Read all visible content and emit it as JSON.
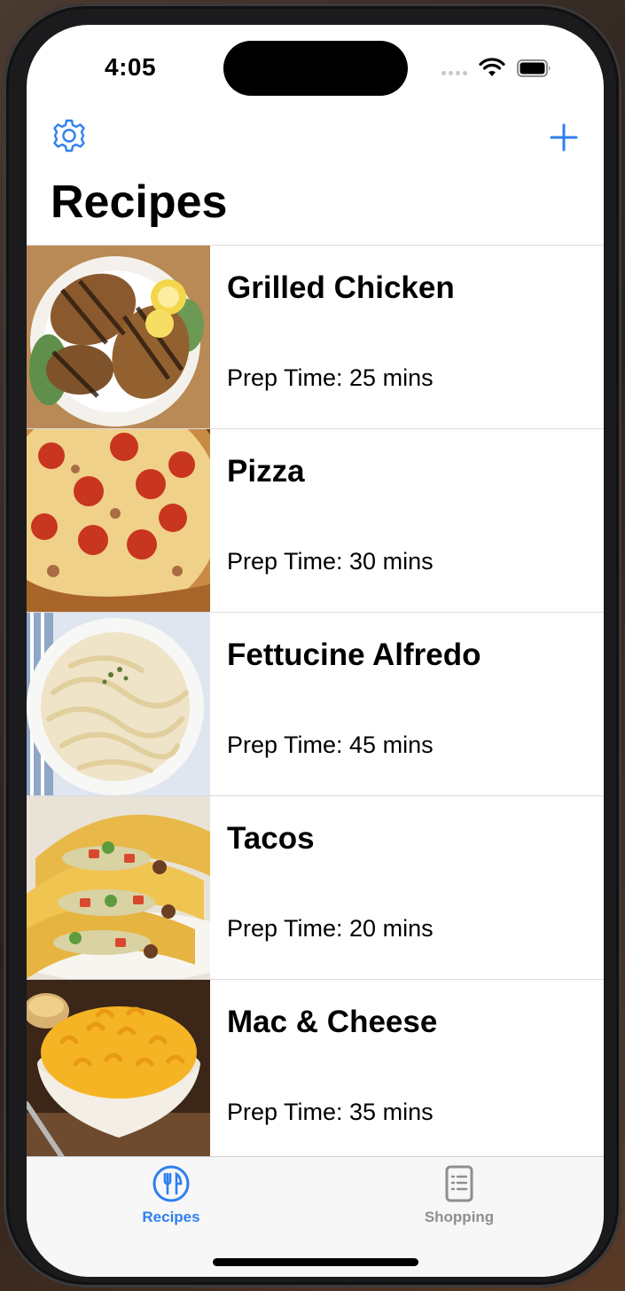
{
  "status_bar": {
    "time": "4:05"
  },
  "nav": {
    "settings_icon": "gear-icon",
    "add_icon": "plus-icon",
    "title": "Recipes"
  },
  "recipes": [
    {
      "name": "Grilled Chicken",
      "prep": "Prep Time: 25 mins",
      "image": "grilled-chicken"
    },
    {
      "name": "Pizza",
      "prep": "Prep Time: 30 mins",
      "image": "pizza"
    },
    {
      "name": "Fettucine Alfredo",
      "prep": "Prep Time: 45 mins",
      "image": "fettucine-alfredo"
    },
    {
      "name": "Tacos",
      "prep": "Prep Time: 20 mins",
      "image": "tacos"
    },
    {
      "name": "Mac & Cheese",
      "prep": "Prep Time: 35 mins",
      "image": "mac-and-cheese"
    }
  ],
  "tab_bar": {
    "tabs": [
      {
        "label": "Recipes",
        "icon": "fork-knife-icon",
        "selected": true
      },
      {
        "label": "Shopping",
        "icon": "list-clipboard-icon",
        "selected": false
      }
    ]
  },
  "colors": {
    "accent": "#2f7ff0",
    "inactive": "#8e8e93",
    "separator": "#dcdcdf"
  }
}
